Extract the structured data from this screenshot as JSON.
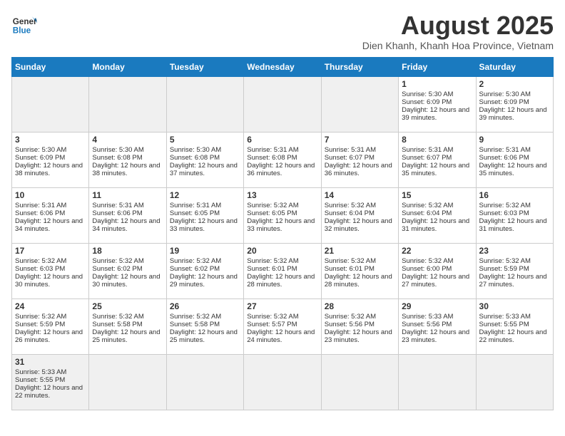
{
  "header": {
    "logo_general": "General",
    "logo_blue": "Blue",
    "title": "August 2025",
    "subtitle": "Dien Khanh, Khanh Hoa Province, Vietnam"
  },
  "days_of_week": [
    "Sunday",
    "Monday",
    "Tuesday",
    "Wednesday",
    "Thursday",
    "Friday",
    "Saturday"
  ],
  "weeks": [
    [
      {
        "day": "",
        "info": ""
      },
      {
        "day": "",
        "info": ""
      },
      {
        "day": "",
        "info": ""
      },
      {
        "day": "",
        "info": ""
      },
      {
        "day": "",
        "info": ""
      },
      {
        "day": "1",
        "info": "Sunrise: 5:30 AM\nSunset: 6:09 PM\nDaylight: 12 hours and 39 minutes."
      },
      {
        "day": "2",
        "info": "Sunrise: 5:30 AM\nSunset: 6:09 PM\nDaylight: 12 hours and 39 minutes."
      }
    ],
    [
      {
        "day": "3",
        "info": "Sunrise: 5:30 AM\nSunset: 6:09 PM\nDaylight: 12 hours and 38 minutes."
      },
      {
        "day": "4",
        "info": "Sunrise: 5:30 AM\nSunset: 6:08 PM\nDaylight: 12 hours and 38 minutes."
      },
      {
        "day": "5",
        "info": "Sunrise: 5:30 AM\nSunset: 6:08 PM\nDaylight: 12 hours and 37 minutes."
      },
      {
        "day": "6",
        "info": "Sunrise: 5:31 AM\nSunset: 6:08 PM\nDaylight: 12 hours and 36 minutes."
      },
      {
        "day": "7",
        "info": "Sunrise: 5:31 AM\nSunset: 6:07 PM\nDaylight: 12 hours and 36 minutes."
      },
      {
        "day": "8",
        "info": "Sunrise: 5:31 AM\nSunset: 6:07 PM\nDaylight: 12 hours and 35 minutes."
      },
      {
        "day": "9",
        "info": "Sunrise: 5:31 AM\nSunset: 6:06 PM\nDaylight: 12 hours and 35 minutes."
      }
    ],
    [
      {
        "day": "10",
        "info": "Sunrise: 5:31 AM\nSunset: 6:06 PM\nDaylight: 12 hours and 34 minutes."
      },
      {
        "day": "11",
        "info": "Sunrise: 5:31 AM\nSunset: 6:06 PM\nDaylight: 12 hours and 34 minutes."
      },
      {
        "day": "12",
        "info": "Sunrise: 5:31 AM\nSunset: 6:05 PM\nDaylight: 12 hours and 33 minutes."
      },
      {
        "day": "13",
        "info": "Sunrise: 5:32 AM\nSunset: 6:05 PM\nDaylight: 12 hours and 33 minutes."
      },
      {
        "day": "14",
        "info": "Sunrise: 5:32 AM\nSunset: 6:04 PM\nDaylight: 12 hours and 32 minutes."
      },
      {
        "day": "15",
        "info": "Sunrise: 5:32 AM\nSunset: 6:04 PM\nDaylight: 12 hours and 31 minutes."
      },
      {
        "day": "16",
        "info": "Sunrise: 5:32 AM\nSunset: 6:03 PM\nDaylight: 12 hours and 31 minutes."
      }
    ],
    [
      {
        "day": "17",
        "info": "Sunrise: 5:32 AM\nSunset: 6:03 PM\nDaylight: 12 hours and 30 minutes."
      },
      {
        "day": "18",
        "info": "Sunrise: 5:32 AM\nSunset: 6:02 PM\nDaylight: 12 hours and 30 minutes."
      },
      {
        "day": "19",
        "info": "Sunrise: 5:32 AM\nSunset: 6:02 PM\nDaylight: 12 hours and 29 minutes."
      },
      {
        "day": "20",
        "info": "Sunrise: 5:32 AM\nSunset: 6:01 PM\nDaylight: 12 hours and 28 minutes."
      },
      {
        "day": "21",
        "info": "Sunrise: 5:32 AM\nSunset: 6:01 PM\nDaylight: 12 hours and 28 minutes."
      },
      {
        "day": "22",
        "info": "Sunrise: 5:32 AM\nSunset: 6:00 PM\nDaylight: 12 hours and 27 minutes."
      },
      {
        "day": "23",
        "info": "Sunrise: 5:32 AM\nSunset: 5:59 PM\nDaylight: 12 hours and 27 minutes."
      }
    ],
    [
      {
        "day": "24",
        "info": "Sunrise: 5:32 AM\nSunset: 5:59 PM\nDaylight: 12 hours and 26 minutes."
      },
      {
        "day": "25",
        "info": "Sunrise: 5:32 AM\nSunset: 5:58 PM\nDaylight: 12 hours and 25 minutes."
      },
      {
        "day": "26",
        "info": "Sunrise: 5:32 AM\nSunset: 5:58 PM\nDaylight: 12 hours and 25 minutes."
      },
      {
        "day": "27",
        "info": "Sunrise: 5:32 AM\nSunset: 5:57 PM\nDaylight: 12 hours and 24 minutes."
      },
      {
        "day": "28",
        "info": "Sunrise: 5:32 AM\nSunset: 5:56 PM\nDaylight: 12 hours and 23 minutes."
      },
      {
        "day": "29",
        "info": "Sunrise: 5:33 AM\nSunset: 5:56 PM\nDaylight: 12 hours and 23 minutes."
      },
      {
        "day": "30",
        "info": "Sunrise: 5:33 AM\nSunset: 5:55 PM\nDaylight: 12 hours and 22 minutes."
      }
    ],
    [
      {
        "day": "31",
        "info": "Sunrise: 5:33 AM\nSunset: 5:55 PM\nDaylight: 12 hours and 22 minutes."
      },
      {
        "day": "",
        "info": ""
      },
      {
        "day": "",
        "info": ""
      },
      {
        "day": "",
        "info": ""
      },
      {
        "day": "",
        "info": ""
      },
      {
        "day": "",
        "info": ""
      },
      {
        "day": "",
        "info": ""
      }
    ]
  ]
}
